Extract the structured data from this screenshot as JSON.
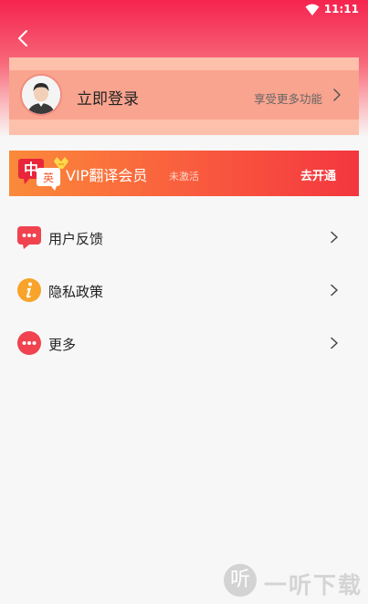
{
  "status_bar": {
    "time": "11:11",
    "wifi_icon": "wifi-icon"
  },
  "header": {
    "back_icon": "chevron-left-icon"
  },
  "login": {
    "label": "立即登录",
    "subtitle": "享受更多功能",
    "avatar_icon": "avatar-icon",
    "chevron_icon": "chevron-right-icon"
  },
  "vip": {
    "badge_char_zh": "中",
    "badge_char_en": "英",
    "title": "VIP翻译会员",
    "status": "未激活",
    "action": "去开通",
    "badge_icon": "translate-badge-icon"
  },
  "menu": {
    "items": [
      {
        "label": "用户反馈",
        "icon": "feedback-icon",
        "color": "#f0434f"
      },
      {
        "label": "隐私政策",
        "icon": "info-icon",
        "color": "#f8a32a"
      },
      {
        "label": "更多",
        "icon": "more-icon",
        "color": "#f0434f"
      }
    ]
  },
  "watermark": {
    "icon_char": "听",
    "text": "一听下载"
  },
  "colors": {
    "header_top": "#f5234e",
    "accent": "#f4363f",
    "vip_start": "#fa8a3a"
  }
}
